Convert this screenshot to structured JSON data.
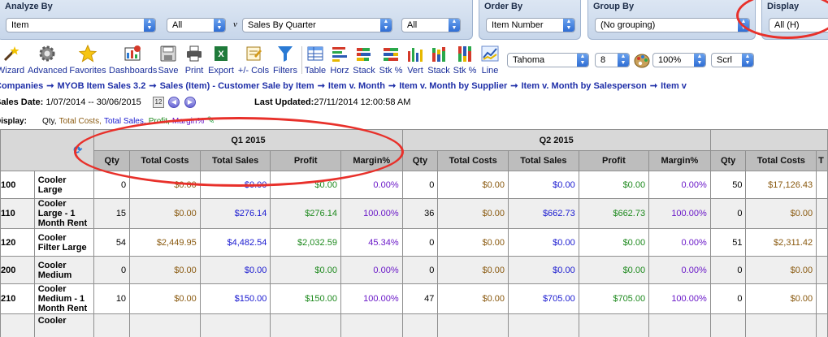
{
  "filters": {
    "analyze_by": {
      "title": "Analyze By",
      "field1": "Item",
      "field2": "All",
      "v_label": "v",
      "field3": "Sales By Quarter",
      "field4": "All"
    },
    "order_by": {
      "title": "Order By",
      "value": "Item Number"
    },
    "group_by": {
      "title": "Group By",
      "value": "(No grouping)"
    },
    "display": {
      "title": "Display",
      "value": "All (H)"
    }
  },
  "toolbar": {
    "wizard": "Wizard",
    "advanced": "Advanced",
    "favorites": "Favorites",
    "dashboards": "Dashboards",
    "save": "Save",
    "print": "Print",
    "export": "Export",
    "cols": "+/- Cols",
    "filters": "Filters",
    "table": "Table",
    "horz": "Horz",
    "stack": "Stack",
    "stk_pct": "Stk %",
    "vert": "Vert",
    "stack2": "Stack",
    "stk_pct2": "Stk %",
    "line": "Line",
    "font": "Tahoma",
    "font_size": "8",
    "zoom": "100%",
    "scroll_mode": "Scrl"
  },
  "breadcrumbs": [
    "Companies",
    "MYOB Item Sales 3.2",
    "Sales (Item) - Customer Sale by Item",
    "Item v. Month",
    "Item v. Month by Supplier",
    "Item v. Month by Salesperson",
    "Item v"
  ],
  "breadcrumb_sep": "➞",
  "info": {
    "sales_date_label": "Sales Date:",
    "sales_date_value": "1/07/2014 -- 30/06/2015",
    "last_updated_label": "Last Updated:",
    "last_updated_value": "27/11/2014 12:00:58 AM",
    "display_label": "Display:",
    "display_items": [
      "Qty,",
      "Total Costs,",
      "Total Sales,",
      "Profit,",
      "Margin%"
    ]
  },
  "table": {
    "quarters": [
      "Q1 2015",
      "Q2 2015"
    ],
    "columns": [
      "Qty",
      "Total Costs",
      "Total Sales",
      "Profit",
      "Margin%"
    ],
    "q3_partial": {
      "qty": "Qty",
      "total_costs": "Total Costs",
      "total_sales": "T"
    },
    "rows": [
      {
        "code": "100",
        "desc": "Cooler Large",
        "q1": [
          "0",
          "$0.00",
          "$0.00",
          "$0.00",
          "0.00%"
        ],
        "q2": [
          "0",
          "$0.00",
          "$0.00",
          "$0.00",
          "0.00%"
        ],
        "q3": [
          "50",
          "$17,126.43"
        ]
      },
      {
        "code": "110",
        "desc": "Cooler Large - 1 Month Rent",
        "q1": [
          "15",
          "$0.00",
          "$276.14",
          "$276.14",
          "100.00%"
        ],
        "q2": [
          "36",
          "$0.00",
          "$662.73",
          "$662.73",
          "100.00%"
        ],
        "q3": [
          "0",
          "$0.00"
        ]
      },
      {
        "code": "120",
        "desc": "Cooler Filter Large",
        "q1": [
          "54",
          "$2,449.95",
          "$4,482.54",
          "$2,032.59",
          "45.34%"
        ],
        "q2": [
          "0",
          "$0.00",
          "$0.00",
          "$0.00",
          "0.00%"
        ],
        "q3": [
          "51",
          "$2,311.42"
        ]
      },
      {
        "code": "200",
        "desc": "Cooler Medium",
        "q1": [
          "0",
          "$0.00",
          "$0.00",
          "$0.00",
          "0.00%"
        ],
        "q2": [
          "0",
          "$0.00",
          "$0.00",
          "$0.00",
          "0.00%"
        ],
        "q3": [
          "0",
          "$0.00"
        ]
      },
      {
        "code": "210",
        "desc": "Cooler Medium - 1 Month Rent",
        "q1": [
          "10",
          "$0.00",
          "$150.00",
          "$150.00",
          "100.00%"
        ],
        "q2": [
          "47",
          "$0.00",
          "$705.00",
          "$705.00",
          "100.00%"
        ],
        "q3": [
          "0",
          "$0.00"
        ]
      },
      {
        "code": "",
        "desc": "Cooler",
        "q1": [
          "",
          "",
          "",
          "",
          ""
        ],
        "q2": [
          "",
          "",
          "",
          "",
          ""
        ],
        "q3": [
          "",
          ""
        ]
      }
    ]
  },
  "icons": {
    "wizard": "magic-wand-icon",
    "advanced": "gear-icon",
    "favorites": "star-icon",
    "dashboards": "dashboard-icon",
    "save": "disk-icon",
    "print": "printer-icon",
    "export": "excel-icon",
    "cols": "columns-icon",
    "filters": "funnel-icon",
    "refresh": "refresh-icon"
  },
  "colors": {
    "accent_link": "#1f2fa8",
    "qty": "#000000",
    "total_costs": "#8a5a10",
    "total_sales": "#1a1ad0",
    "profit": "#1f8a1f",
    "margin": "#6a18c8",
    "annotation": "#e8302a"
  }
}
